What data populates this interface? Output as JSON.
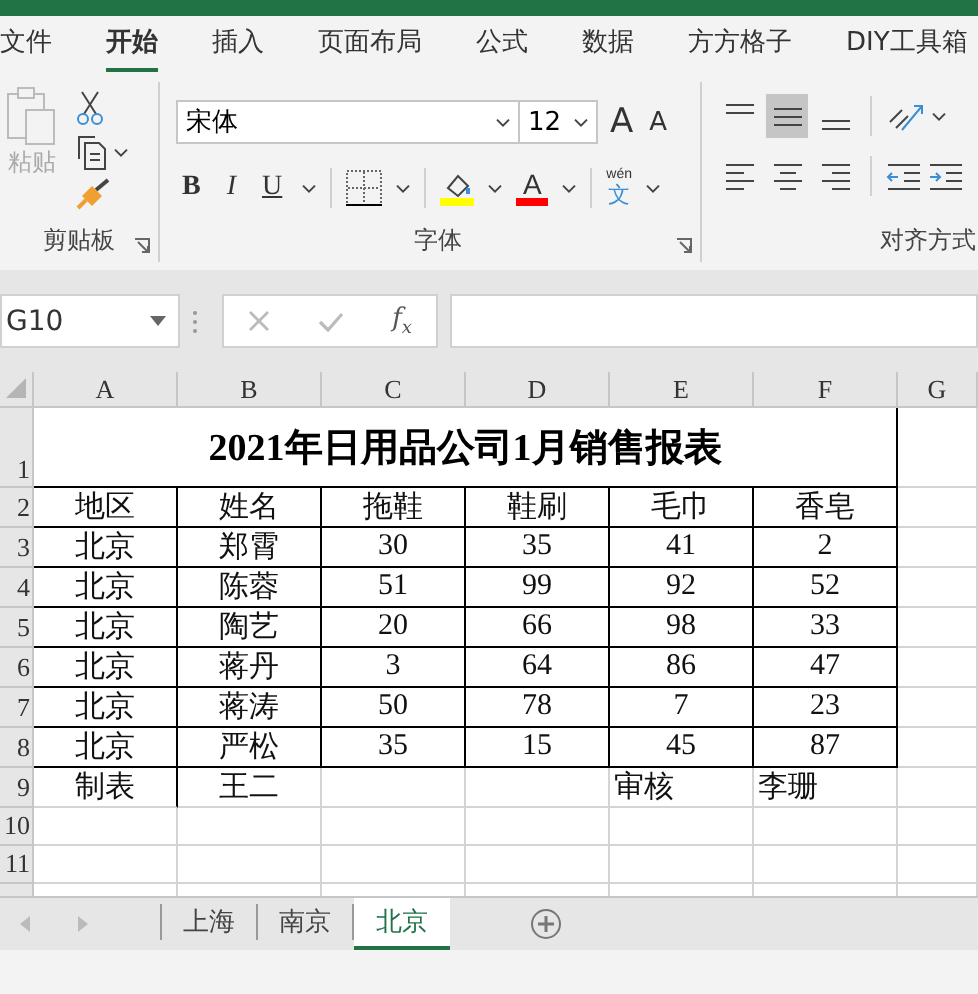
{
  "ribbon_tabs": [
    {
      "label": "文件",
      "selected": false
    },
    {
      "label": "开始",
      "selected": true
    },
    {
      "label": "插入",
      "selected": false
    },
    {
      "label": "页面布局",
      "selected": false
    },
    {
      "label": "公式",
      "selected": false
    },
    {
      "label": "数据",
      "selected": false
    },
    {
      "label": "方方格子",
      "selected": false
    },
    {
      "label": "DIY工具箱",
      "selected": false
    }
  ],
  "clipboard": {
    "paste_label": "粘贴",
    "paste_disabled": true,
    "group_label": "剪贴板"
  },
  "font": {
    "name": "宋体",
    "size": "12",
    "grow": "A",
    "shrink": "A",
    "bold": "B",
    "italic": "I",
    "underline": "U",
    "font_color_letter": "A",
    "phonetic_top": "wén",
    "phonetic_bottom": "文",
    "group_label": "字体"
  },
  "alignment": {
    "vertical": [
      {
        "kind": "top",
        "selected": false
      },
      {
        "kind": "middle",
        "selected": true
      },
      {
        "kind": "bottom",
        "selected": false
      }
    ],
    "group_label": "对齐方式"
  },
  "formula_bar": {
    "name_box": "G10",
    "fx": "f$_{x}$"
  },
  "sheet": {
    "columns": [
      "A",
      "B",
      "C",
      "D",
      "E",
      "F",
      "G"
    ],
    "row_numbers": [
      "1",
      "2",
      "3",
      "4",
      "5",
      "6",
      "7",
      "8",
      "9",
      "10",
      "11"
    ],
    "title": "2021年日用品公司1月销售报表",
    "header": [
      "地区",
      "姓名",
      "拖鞋",
      "鞋刷",
      "毛巾",
      "香皂"
    ],
    "rows": [
      [
        "北京",
        "郑霄",
        "30",
        "35",
        "41",
        "2"
      ],
      [
        "北京",
        "陈蓉",
        "51",
        "99",
        "92",
        "52"
      ],
      [
        "北京",
        "陶艺",
        "20",
        "66",
        "98",
        "33"
      ],
      [
        "北京",
        "蒋丹",
        "3",
        "64",
        "86",
        "47"
      ],
      [
        "北京",
        "蒋涛",
        "50",
        "78",
        "7",
        "23"
      ],
      [
        "北京",
        "严松",
        "35",
        "15",
        "45",
        "87"
      ]
    ],
    "footer": {
      "preparer_label": "制表",
      "preparer": "王二",
      "reviewer_label": "审核",
      "reviewer": "李珊"
    }
  },
  "sheet_tabs": [
    {
      "label": "上海",
      "selected": false
    },
    {
      "label": "南京",
      "selected": false
    },
    {
      "label": "北京",
      "selected": true
    }
  ]
}
